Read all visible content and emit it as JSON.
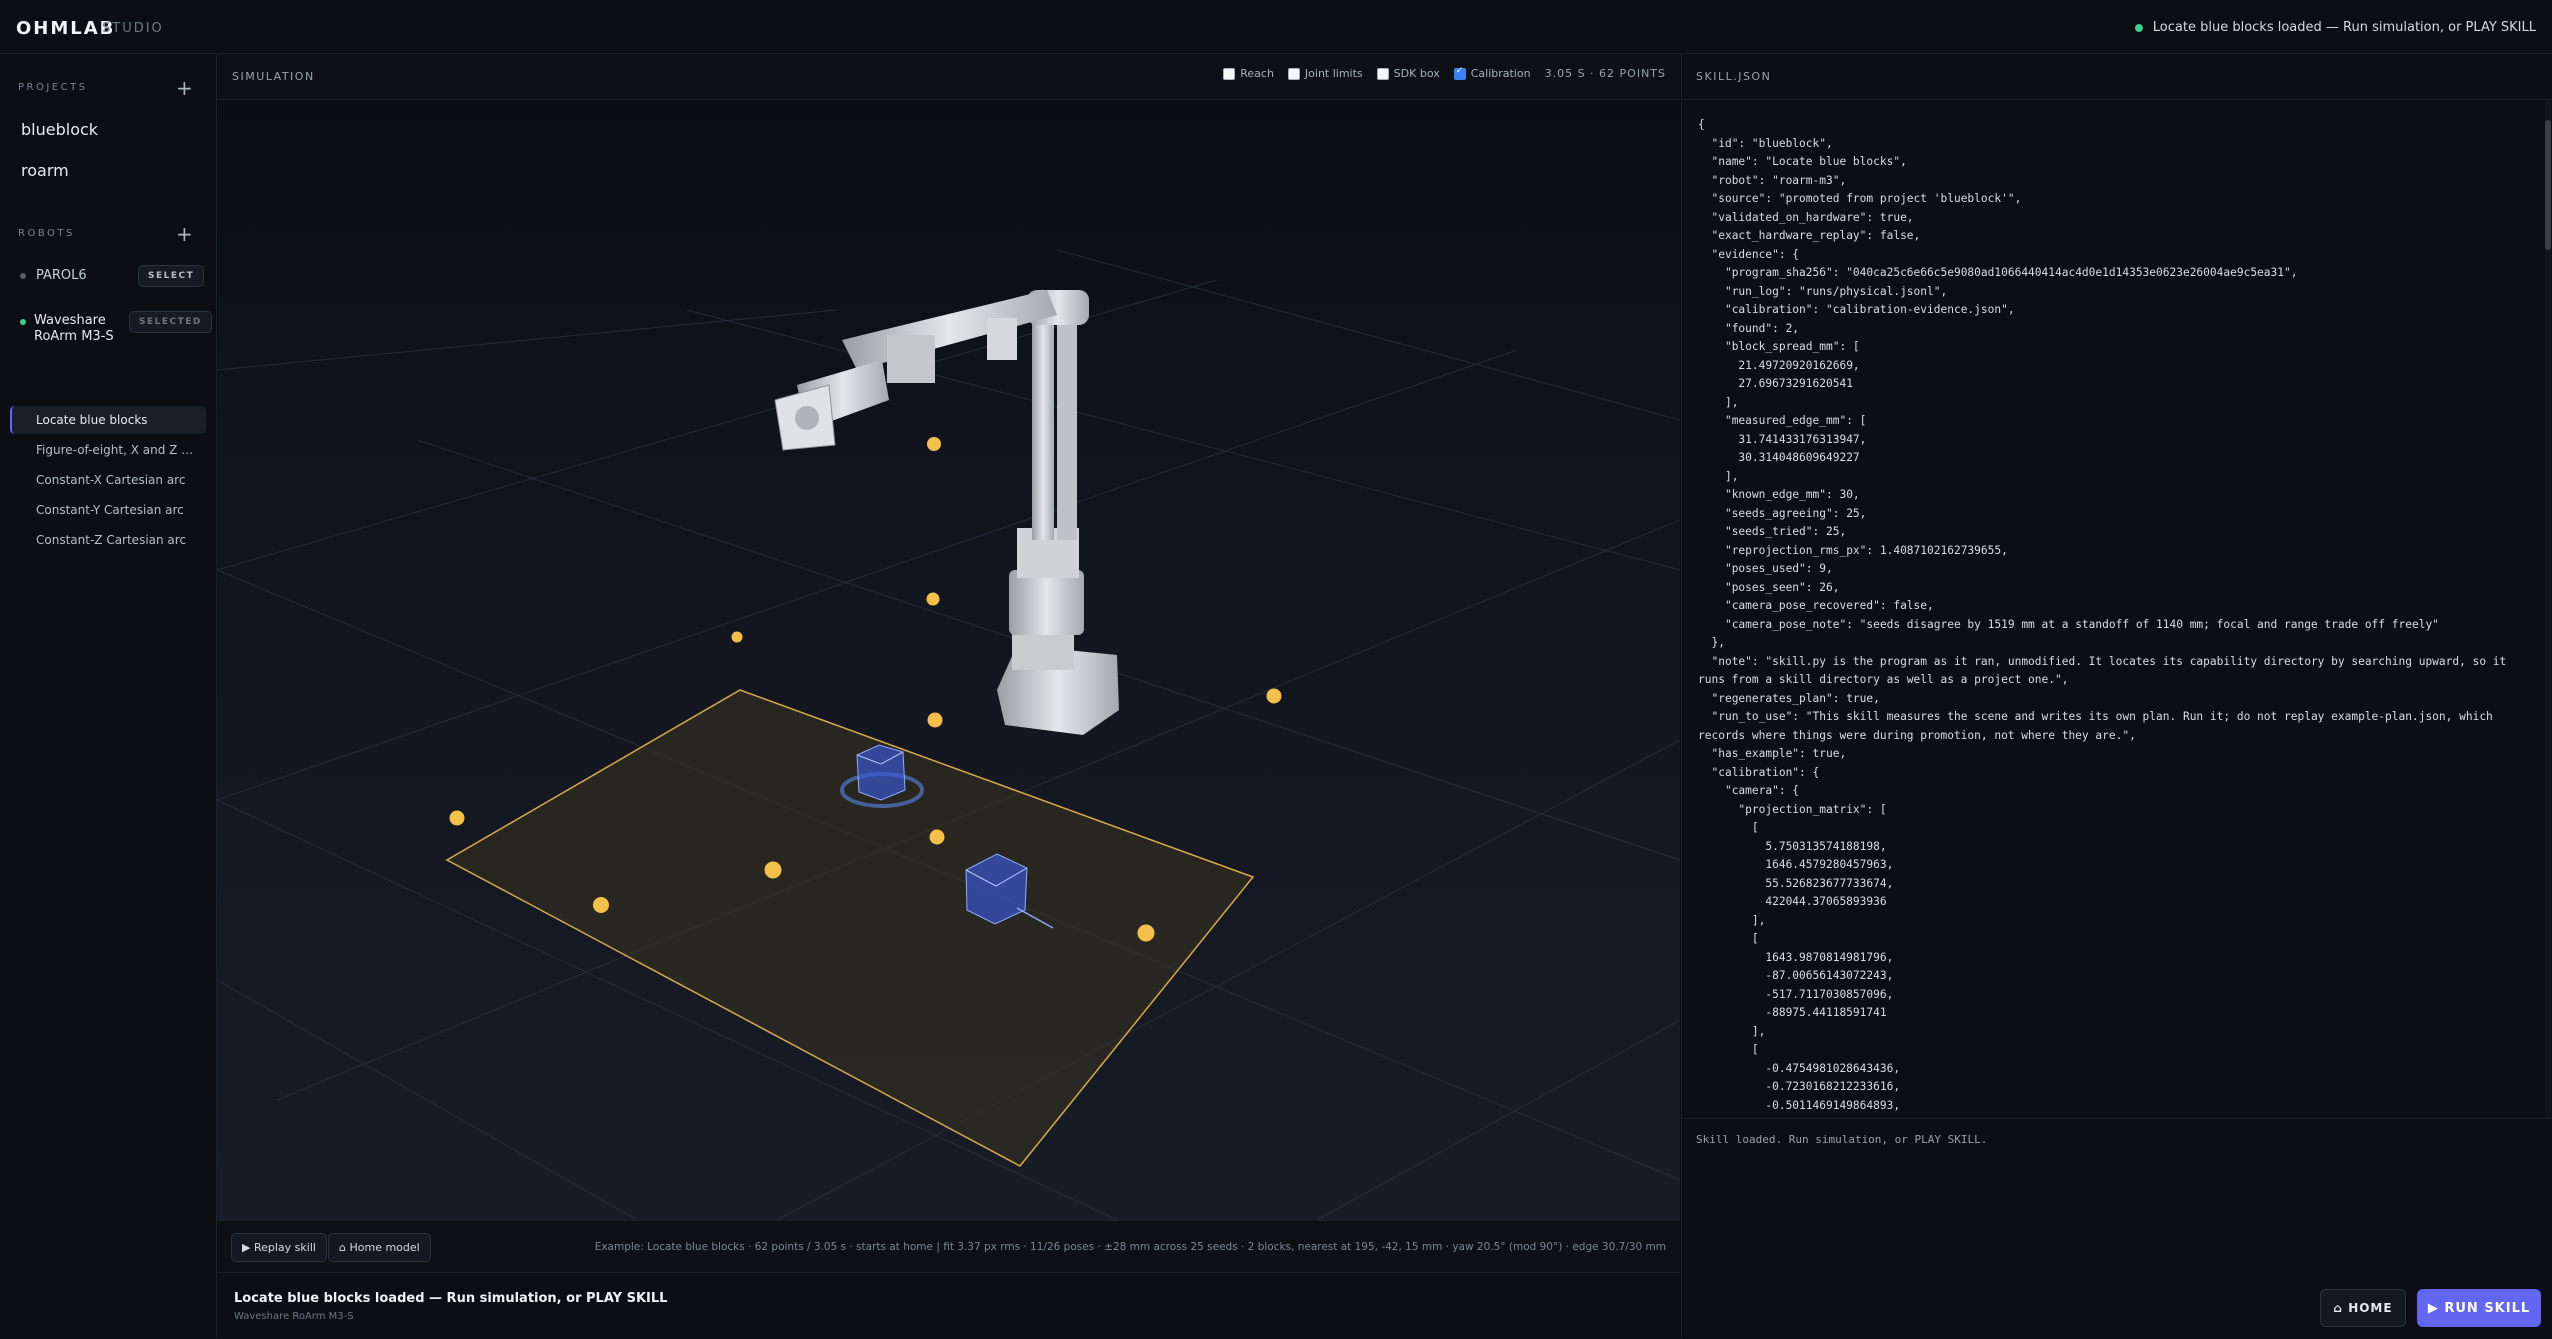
{
  "app": {
    "brand": "OHMLAB",
    "brand_sub": "STUDIO",
    "status": "Locate blue blocks loaded — Run simulation, or PLAY SKILL"
  },
  "sidebar": {
    "projects_title": "PROJECTS",
    "projects": [
      "blueblock",
      "roarm"
    ],
    "robots_title": "ROBOTS",
    "robots": [
      {
        "name": "PAROL6",
        "action": "SELECT"
      },
      {
        "name_line1": "Waveshare",
        "name_line2": "RoArm M3-S",
        "action": "SELECTED"
      }
    ],
    "skills": [
      "Locate blue blocks",
      "Figure-of-eight, X and Z pla...",
      "Constant-X Cartesian arc",
      "Constant-Y Cartesian arc",
      "Constant-Z Cartesian arc"
    ]
  },
  "simulation": {
    "title": "SIMULATION",
    "toggles": [
      {
        "label": "Reach",
        "checked": false
      },
      {
        "label": "Joint limits",
        "checked": false
      },
      {
        "label": "SDK box",
        "checked": false
      },
      {
        "label": "Calibration",
        "checked": true
      }
    ],
    "readout": "3.05 S · 62 POINTS",
    "replay_label": "▶ Replay skill",
    "home_model_label": "⌂ Home model",
    "note": "Example: Locate blue blocks · 62 points / 3.05 s · starts at home | fit 3.37 px rms · 11/26 poses · ±28 mm across 25 seeds · 2 blocks, nearest at 195, -42, 15 mm · yaw 20.5° (mod 90°) · edge 30.7/30 mm"
  },
  "status_bar": {
    "title": "Locate blue blocks loaded — Run simulation, or PLAY SKILL",
    "subtitle": "Waveshare RoArm M3-S"
  },
  "json_panel": {
    "title": "SKILL.JSON",
    "code": "{\n  \"id\": \"blueblock\",\n  \"name\": \"Locate blue blocks\",\n  \"robot\": \"roarm-m3\",\n  \"source\": \"promoted from project 'blueblock'\",\n  \"validated_on_hardware\": true,\n  \"exact_hardware_replay\": false,\n  \"evidence\": {\n    \"program_sha256\": \"040ca25c6e66c5e9080ad1066440414ac4d0e1d14353e0623e26004ae9c5ea31\",\n    \"run_log\": \"runs/physical.jsonl\",\n    \"calibration\": \"calibration-evidence.json\",\n    \"found\": 2,\n    \"block_spread_mm\": [\n      21.49720920162669,\n      27.69673291620541\n    ],\n    \"measured_edge_mm\": [\n      31.741433176313947,\n      30.314048609649227\n    ],\n    \"known_edge_mm\": 30,\n    \"seeds_agreeing\": 25,\n    \"seeds_tried\": 25,\n    \"reprojection_rms_px\": 1.4087102162739655,\n    \"poses_used\": 9,\n    \"poses_seen\": 26,\n    \"camera_pose_recovered\": false,\n    \"camera_pose_note\": \"seeds disagree by 1519 mm at a standoff of 1140 mm; focal and range trade off freely\"\n  },\n  \"note\": \"skill.py is the program as it ran, unmodified. It locates its capability directory by searching upward, so it runs from a skill directory as well as a project one.\",\n  \"regenerates_plan\": true,\n  \"run_to_use\": \"This skill measures the scene and writes its own plan. Run it; do not replay example-plan.json, which records where things were during promotion, not where they are.\",\n  \"has_example\": true,\n  \"calibration\": {\n    \"camera\": {\n      \"projection_matrix\": [\n        [\n          5.750313574188198,\n          1646.4579280457963,\n          55.526823677733674,\n          422044.37065893936\n        ],\n        [\n          1643.9870814981796,\n          -87.00656143072243,\n          -517.7117030857096,\n          -88975.44118591741\n        ],\n        [\n          -0.4754981028643436,\n          -0.7230168212233616,\n          -0.5011469149864893,",
    "log": "Skill loaded. Run simulation, or PLAY SKILL."
  },
  "actions": {
    "home_label": "⌂ HOME",
    "run_label": "▶ RUN SKILL",
    "accent": "#6366f1"
  }
}
